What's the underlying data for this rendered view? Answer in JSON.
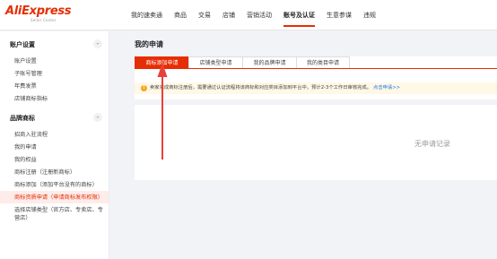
{
  "logo": {
    "text": "AliExpress",
    "sub": "Seller Center"
  },
  "nav": [
    "我的速卖通",
    "商品",
    "交易",
    "店铺",
    "营销活动",
    "账号及认证",
    "生意参谋",
    "违规"
  ],
  "nav_active_index": 5,
  "sidebar": {
    "sections": [
      {
        "title": "账户设置",
        "toggle": "-",
        "items": [
          "账户设置",
          "子账号管理",
          "年费发票",
          "店铺商标指标"
        ]
      },
      {
        "title": "品牌商标",
        "toggle": "-",
        "items": [
          "招商入驻流程",
          "我的申请",
          "我的权益",
          "商标注册（注册新商标）",
          "商标添加（添加平台没有的商标）",
          "商标资质申请（申请商标发布权限）",
          "选择店铺类型（官方店、专卖店、专营店）"
        ]
      }
    ],
    "active_item": "商标资质申请（申请商标发布权限）"
  },
  "main": {
    "title": "我的申请",
    "tabs": [
      "商标添加申请",
      "店铺类型申请",
      "我的品牌申请",
      "我的类目申请"
    ],
    "active_tab": 0,
    "notice": {
      "text": "卖家完成商标注册后，需要通过认证流程将该商标和对应类目添加到平台中，预计2-3个工作日审核完成。",
      "link": "点击申请>>"
    },
    "empty_text": "无申请记录"
  },
  "colors": {
    "accent": "#e62e04",
    "annotation_arrow": "#e8413a"
  }
}
